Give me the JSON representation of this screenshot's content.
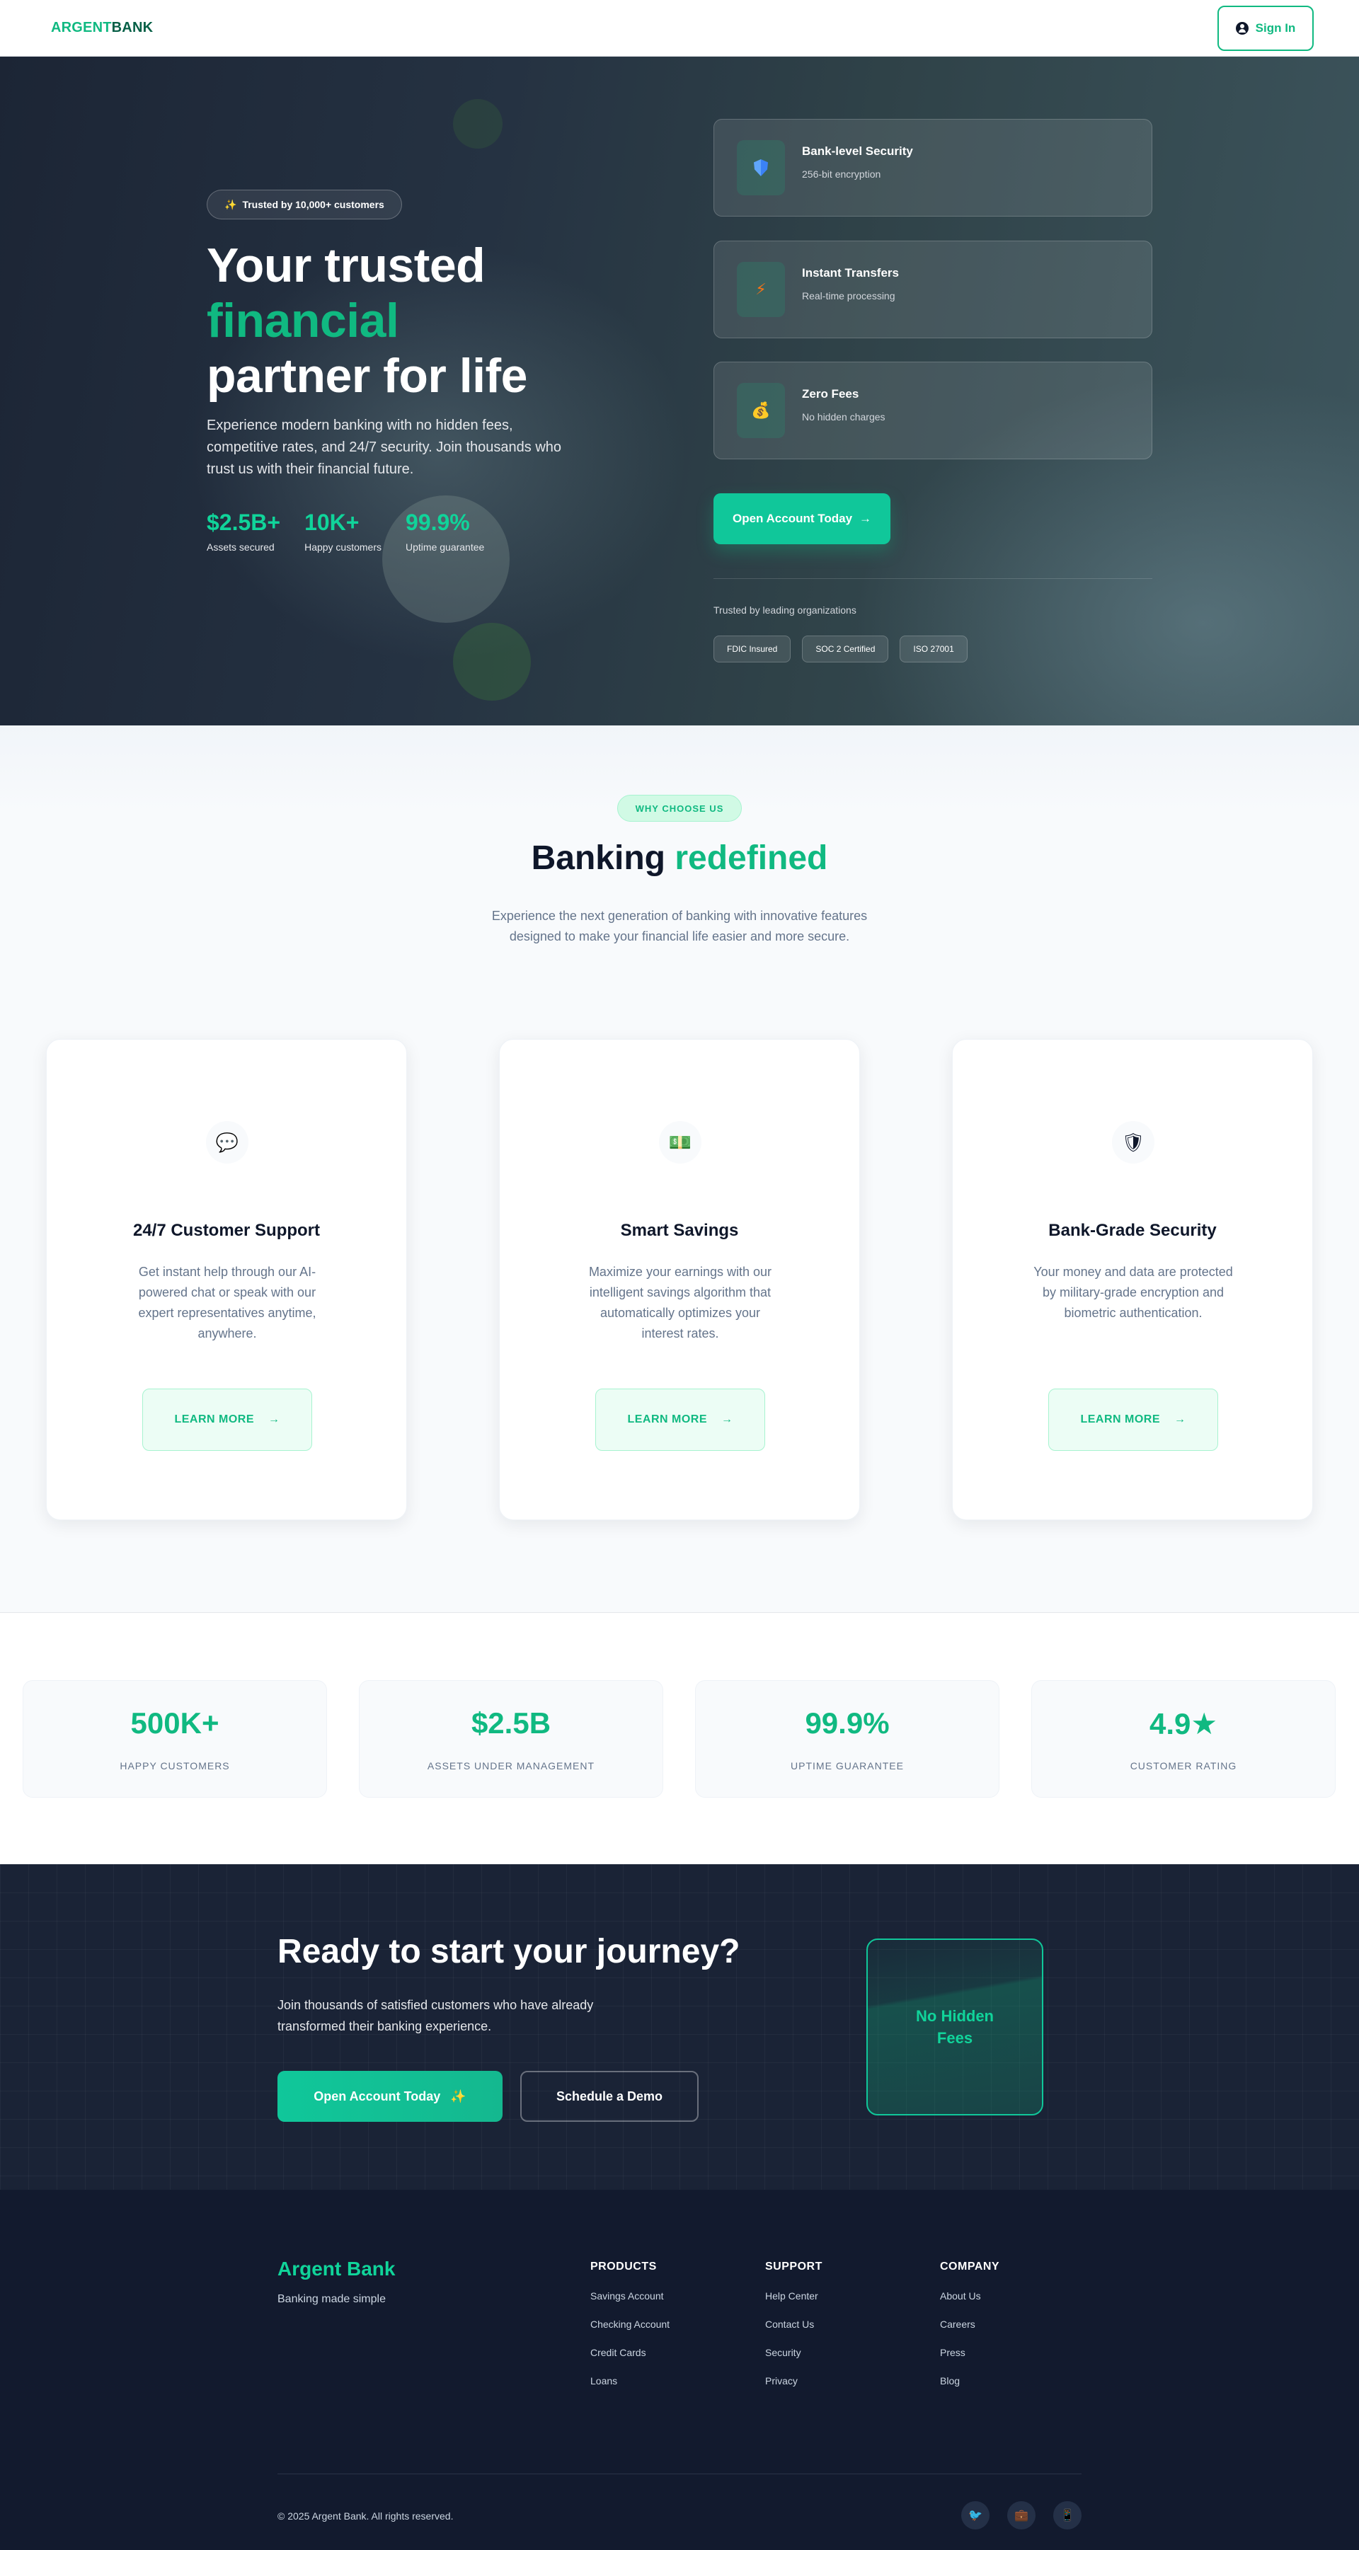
{
  "nav": {
    "logo_part1": "ARGENT",
    "logo_part2": "BANK",
    "signin_label": "Sign In",
    "user_icon": "user-circle-icon"
  },
  "hero": {
    "badge": "Trusted by 10,000+ customers",
    "badge_icon": "sparkles-icon",
    "title_line1": "Your trusted",
    "title_line2": "financial",
    "title_line3": "partner for life",
    "description": "Experience modern banking with no hidden fees, competitive rates, and 24/7 security. Join thousands who trust us with their financial future.",
    "stats": [
      {
        "value": "$2.5B+",
        "label": "Assets secured"
      },
      {
        "value": "10K+",
        "label": "Happy customers"
      },
      {
        "value": "99.9%",
        "label": "Uptime guarantee"
      }
    ],
    "features": [
      {
        "icon": "shield-icon",
        "title": "Bank-level Security",
        "subtitle": "256-bit encryption"
      },
      {
        "icon": "lightning-icon",
        "title": "Instant Transfers",
        "subtitle": "Real-time processing"
      },
      {
        "icon": "money-bag-icon",
        "title": "Zero Fees",
        "subtitle": "No hidden charges"
      }
    ],
    "cta_label": "Open Account Today",
    "cta_arrow": "→",
    "trusted_label": "Trusted by leading organizations",
    "certs": [
      "FDIC Insured",
      "SOC 2 Certified",
      "ISO 27001"
    ]
  },
  "features_section": {
    "pill": "WHY CHOOSE US",
    "title_part1": "Banking",
    "title_part2": "redefined",
    "subtitle": "Experience the next generation of banking with innovative features designed to make your financial life easier and more secure.",
    "cards": [
      {
        "icon": "chat-bubbles-icon",
        "title": "24/7 Customer Support",
        "description": "Get instant help through our AI-powered chat or speak with our expert representatives anytime, anywhere.",
        "button": "LEARN MORE",
        "arrow": "→"
      },
      {
        "icon": "money-icon",
        "title": "Smart Savings",
        "description": "Maximize your earnings with our intelligent savings algorithm that automatically optimizes your interest rates.",
        "button": "LEARN MORE",
        "arrow": "→"
      },
      {
        "icon": "shield-check-icon",
        "title": "Bank-Grade Security",
        "description": "Your money and data are protected by military-grade encryption and biometric authentication.",
        "button": "LEARN MORE",
        "arrow": "→"
      }
    ]
  },
  "stats_band": [
    {
      "value": "500K+",
      "label": "HAPPY CUSTOMERS"
    },
    {
      "value": "$2.5B",
      "label": "ASSETS UNDER MANAGEMENT"
    },
    {
      "value": "99.9%",
      "label": "UPTIME GUARANTEE"
    },
    {
      "value": "4.9★",
      "label": "CUSTOMER RATING"
    }
  ],
  "cta": {
    "title": "Ready to start your journey?",
    "description": "Join thousands of satisfied customers who have already transformed their banking experience.",
    "primary": "Open Account Today",
    "primary_icon": "sparkles-icon",
    "secondary": "Schedule a Demo",
    "highlight": "No Hidden Fees"
  },
  "footer": {
    "brand": "Argent Bank",
    "tagline": "Banking made simple",
    "columns": [
      {
        "heading": "PRODUCTS",
        "links": [
          "Savings Account",
          "Checking Account",
          "Credit Cards",
          "Loans"
        ]
      },
      {
        "heading": "SUPPORT",
        "links": [
          "Help Center",
          "Contact Us",
          "Security",
          "Privacy"
        ]
      },
      {
        "heading": "COMPANY",
        "links": [
          "About Us",
          "Careers",
          "Press",
          "Blog"
        ]
      }
    ],
    "copyright": "© 2025 Argent Bank. All rights reserved.",
    "social_icons": [
      "bird-icon",
      "briefcase-icon",
      "phone-icon"
    ]
  }
}
